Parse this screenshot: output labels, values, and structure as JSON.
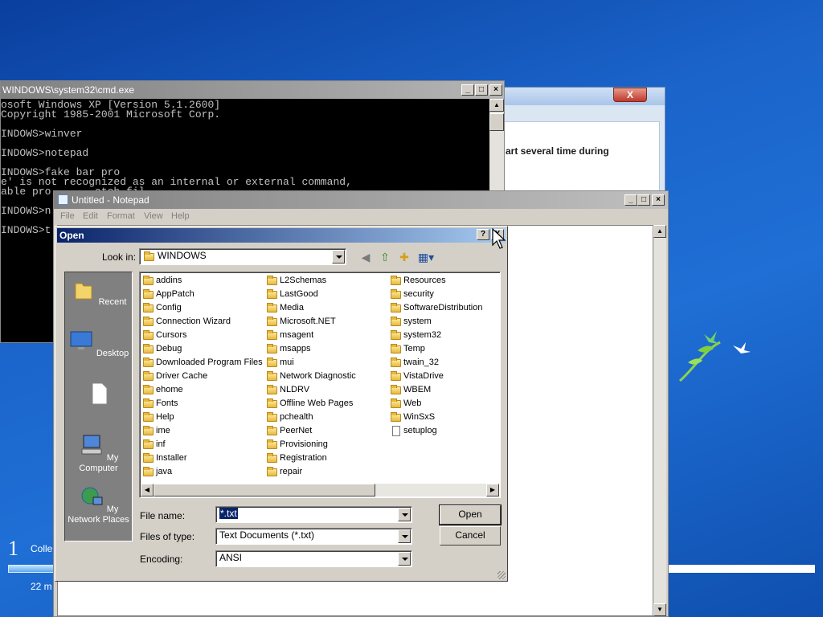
{
  "win7": {
    "close_glyph": "X",
    "partial_text": "art several time during",
    "step_number": "1",
    "step_label": "Colle",
    "time_text": "22 m"
  },
  "cmd": {
    "title": "WINDOWS\\system32\\cmd.exe",
    "lines": [
      "osoft Windows XP [Version 5.1.2600]",
      "Copyright 1985-2001 Microsoft Corp.",
      "",
      "INDOWS>winver",
      "",
      "INDOWS>notepad",
      "",
      "INDOWS>fake bar pro",
      "e' is not recognized as an internal or external command,",
      "able pro       atch fil",
      "",
      "INDOWS>n",
      "",
      "INDOWS>t"
    ]
  },
  "notepad": {
    "title": "Untitled - Notepad",
    "menu": [
      "File",
      "Edit",
      "Format",
      "View",
      "Help"
    ]
  },
  "open_dialog": {
    "title": "Open",
    "help_glyph": "?",
    "close_glyph": "X",
    "look_in_label": "Look in:",
    "look_in_value": "WINDOWS",
    "places": [
      "Recent",
      "Desktop",
      "",
      "My Computer",
      "My Network Places"
    ],
    "columns": [
      [
        "addins",
        "AppPatch",
        "Config",
        "Connection Wizard",
        "Cursors",
        "Debug",
        "Downloaded Program Files",
        "Driver Cache",
        "ehome",
        "Fonts",
        "Help",
        "ime",
        "inf",
        "Installer",
        "java"
      ],
      [
        "L2Schemas",
        "LastGood",
        "Media",
        "Microsoft.NET",
        "msagent",
        "msapps",
        "mui",
        "Network Diagnostic",
        "NLDRV",
        "Offline Web Pages",
        "pchealth",
        "PeerNet",
        "Provisioning",
        "Registration",
        "repair"
      ],
      [
        "Resources",
        "security",
        "SoftwareDistribution",
        "system",
        "system32",
        "Temp",
        "twain_32",
        "VistaDrive",
        "WBEM",
        "Web",
        "WinSxS",
        "setuplog"
      ]
    ],
    "file_name_label": "File name:",
    "file_name_value": "*.txt",
    "files_of_type_label": "Files of type:",
    "files_of_type_value": "Text Documents (*.txt)",
    "encoding_label": "Encoding:",
    "encoding_value": "ANSI",
    "open_button": "Open",
    "cancel_button": "Cancel"
  }
}
